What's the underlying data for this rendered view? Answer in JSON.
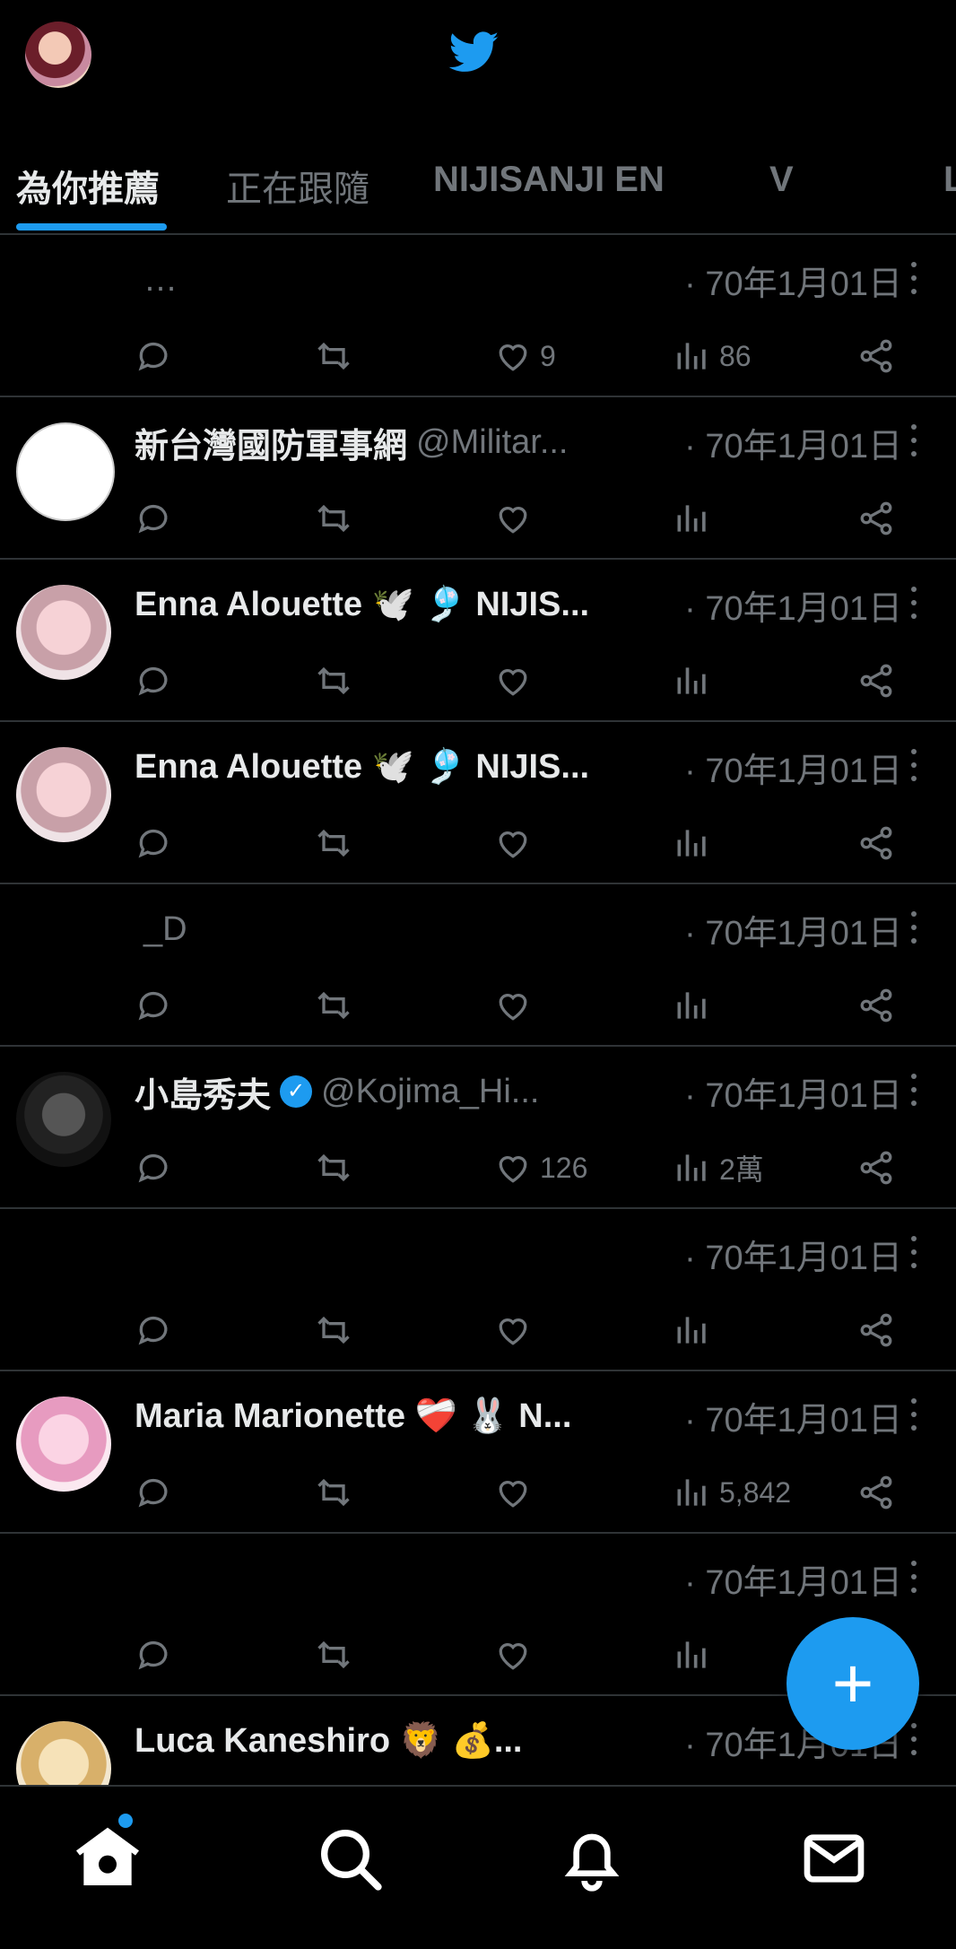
{
  "app": {
    "name": "Twitter",
    "accent_color": "#1d9bf0",
    "background": "#000000"
  },
  "top": {
    "avatar_icon": "user-avatar",
    "logo_icon": "twitter-bird-icon"
  },
  "tabs": [
    {
      "label": "為你推薦",
      "active": true
    },
    {
      "label": "正在跟隨",
      "active": false
    },
    {
      "label": "NIJISANJI EN",
      "active": false
    },
    {
      "label": "V",
      "active": false
    },
    {
      "label": "L",
      "active": false
    }
  ],
  "posts": [
    {
      "name": "",
      "handle": "…",
      "time": "· 70年1月01日",
      "likes": "9",
      "views": "86"
    },
    {
      "name": "新台灣國防軍事網",
      "handle": "@Militar...",
      "time": "· 70年1月01日",
      "likes": "",
      "views": ""
    },
    {
      "name": "Enna Alouette 🕊️ 🎐 NIJIS...",
      "handle": "",
      "time": "· 70年1月01日",
      "likes": "",
      "views": ""
    },
    {
      "name": "Enna Alouette 🕊️ 🎐 NIJIS...",
      "handle": "",
      "time": "· 70年1月01日",
      "likes": "",
      "views": ""
    },
    {
      "name": "",
      "handle": "_D",
      "time": "· 70年1月01日",
      "likes": "",
      "views": ""
    },
    {
      "name": "小島秀夫",
      "handle": "@Kojima_Hi...",
      "time": "· 70年1月01日",
      "likes": "126",
      "views": "2萬"
    },
    {
      "name": "",
      "handle": "",
      "time": "· 70年1月01日",
      "likes": "",
      "views": ""
    },
    {
      "name": "Maria Marionette ❤️‍🩹 🐰 N...",
      "handle": "",
      "time": "· 70年1月01日",
      "likes": "",
      "views": "5,842"
    },
    {
      "name": "",
      "handle": "",
      "time": "· 70年1月01日",
      "likes": "",
      "views": ""
    },
    {
      "name": "Luca Kaneshiro 🦁 💰...",
      "handle": "",
      "time": "· 70年1月01日",
      "likes": "",
      "views": ""
    }
  ],
  "fab": {
    "label": "+"
  },
  "bottom_nav": [
    {
      "icon": "home-icon"
    },
    {
      "icon": "search-icon"
    },
    {
      "icon": "bell-icon"
    },
    {
      "icon": "mail-icon"
    }
  ]
}
